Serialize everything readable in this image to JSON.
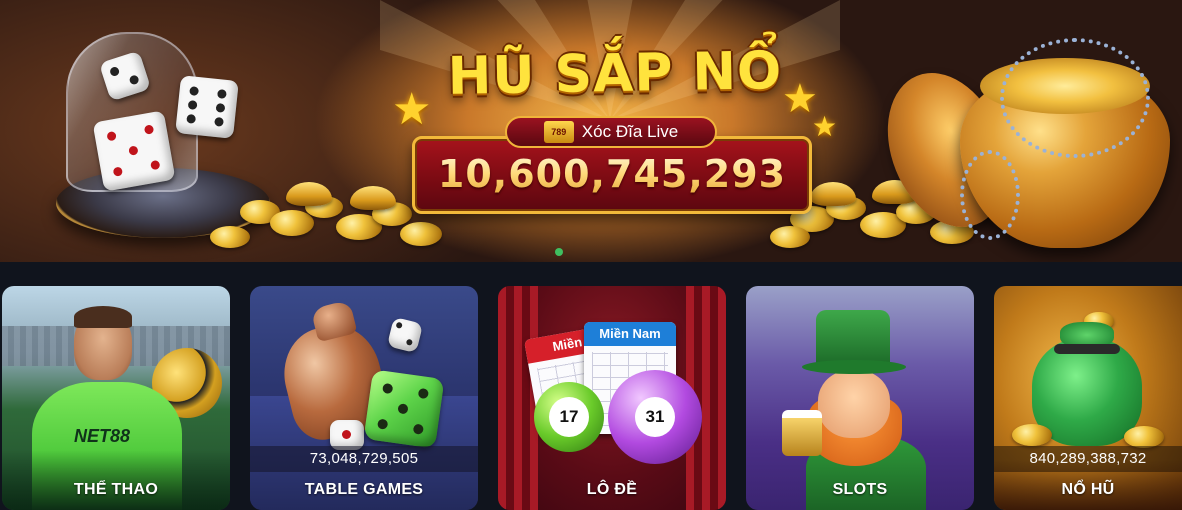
{
  "banner": {
    "title": "HŨ SẮP NỔ",
    "game_logo": "789",
    "game_name": "Xóc Đĩa Live",
    "jackpot_value": "10,600,745,293"
  },
  "games": [
    {
      "label": "THỂ THAO",
      "jersey_text": "NET88"
    },
    {
      "label": "TABLE GAMES",
      "amount": "73,048,729,505"
    },
    {
      "label": "LÔ ĐỀ",
      "ticket_1": "Miền",
      "ticket_2": "Miền Nam",
      "ball_1": "17",
      "ball_2": "31"
    },
    {
      "label": "SLOTS"
    },
    {
      "label": "NỔ HŨ",
      "amount": "840,289,388,732"
    }
  ],
  "colors": {
    "background": "#10141d",
    "accent_gold": "#ffe33d",
    "jackpot_red": "#7c0b13",
    "active_dot": "#3fbf60"
  }
}
